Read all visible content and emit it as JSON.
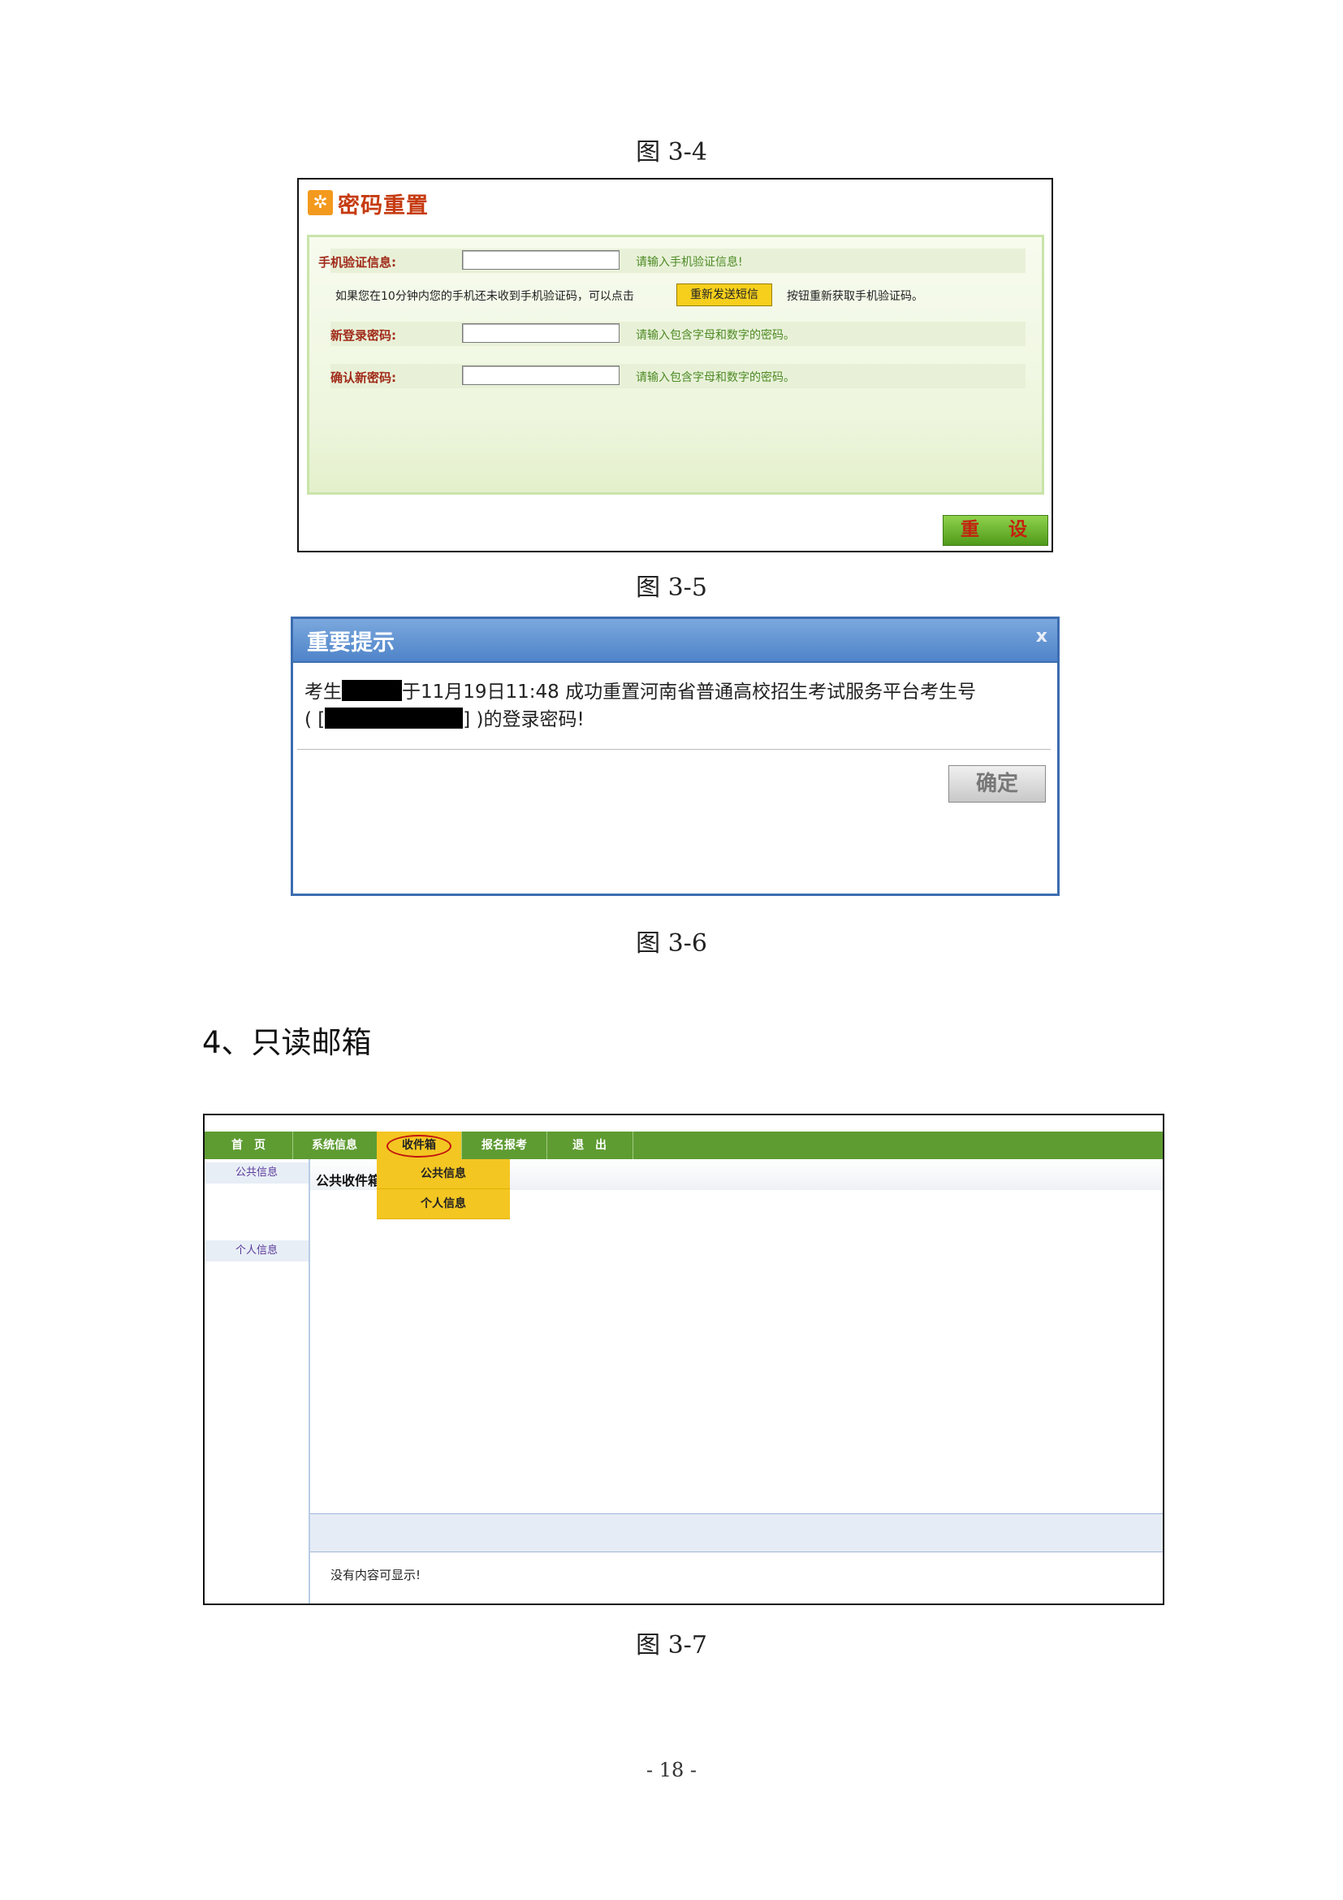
{
  "captions": {
    "fig34": "图 3-4",
    "fig35": "图 3-5",
    "fig36": "图 3-6",
    "fig37": "图 3-7"
  },
  "reset_form": {
    "title": "密码重置",
    "title_icon": "puzzle-gear-icon",
    "phone_code_label": "手机验证信息:",
    "phone_code_hint": "请输入手机验证信息!",
    "resend_text_before": "如果您在10分钟内您的手机还未收到手机验证码，可以点击",
    "resend_button": "重新发送短信",
    "resend_text_after": "按钮重新获取手机验证码。",
    "new_password_label": "新登录密码:",
    "new_password_hint": "请输入包含字母和数字的密码。",
    "confirm_password_label": "确认新密码:",
    "confirm_password_hint": "请输入包含字母和数字的密码。",
    "reset_button": "重 设"
  },
  "dialog": {
    "title": "重要提示",
    "close": "x",
    "line1_prefix": "考生",
    "line1_suffix": "于11月19日11:48 成功重置河南省普通高校招生考试服务平台考生号",
    "line2_prefix": "( [",
    "line2_suffix": "] )的登录密码!",
    "ok_button": "确定"
  },
  "section": {
    "heading": "4、只读邮箱"
  },
  "mailbox": {
    "nav": [
      "首　页",
      "系统信息",
      "收件箱",
      "报名报考",
      "退　出"
    ],
    "dropdown": [
      "公共信息",
      "个人信息"
    ],
    "sidebar": [
      "公共信息",
      "个人信息"
    ],
    "content_title": "公共收件箱",
    "empty_message": "没有内容可显示!"
  },
  "page_number": "- 18 -"
}
